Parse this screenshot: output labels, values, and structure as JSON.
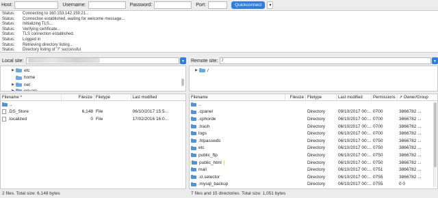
{
  "quickconnect": {
    "host_label": "Host:",
    "username_label": "Username:",
    "password_label": "Password:",
    "port_label": "Port:",
    "host_value": "",
    "username_value": "",
    "password_value": "",
    "port_value": "",
    "button_label": "Quickconnect",
    "dropdown_glyph": "▾"
  },
  "log": [
    {
      "key": "Status:",
      "text": "Connecting to 160.153.142.159:21..."
    },
    {
      "key": "Status:",
      "text": "Connection established, waiting for welcome message..."
    },
    {
      "key": "Status:",
      "text": "Initializing TLS..."
    },
    {
      "key": "Status:",
      "text": "Verifying certificate..."
    },
    {
      "key": "Status:",
      "text": "TLS connection established."
    },
    {
      "key": "Status:",
      "text": "Logged in"
    },
    {
      "key": "Status:",
      "text": "Retrieving directory listing..."
    },
    {
      "key": "Status:",
      "text": "Directory listing of \"/\" successful"
    }
  ],
  "local_site": {
    "label": "Local site:",
    "path": ""
  },
  "remote_site": {
    "label": "Remote site:",
    "path": "/"
  },
  "local_tree": [
    {
      "name": "etc",
      "arrow": "▶"
    },
    {
      "name": "home",
      "arrow": ""
    },
    {
      "name": "net",
      "arrow": "▶"
    },
    {
      "name": "private",
      "arrow": "▶"
    }
  ],
  "remote_tree": [
    {
      "name": "/",
      "arrow": "▶"
    }
  ],
  "local_list": {
    "headers": {
      "filename": "Filename",
      "sort_glyph": "^",
      "filesize": "Filesize",
      "filetype": "Filetype",
      "modified": "Last modified"
    },
    "rows": [
      {
        "name": "..",
        "size": "",
        "type": "",
        "modified": "",
        "kind": "folder"
      },
      {
        "name": ".DS_Store",
        "size": "6,148",
        "type": "File",
        "modified": "06/10/2017 15:5...",
        "kind": "file"
      },
      {
        "name": ".localized",
        "size": "0",
        "type": "File",
        "modified": "17/02/2016 16:0...",
        "kind": "file"
      }
    ],
    "status": "2 files. Total size: 6,148 bytes"
  },
  "remote_list": {
    "headers": {
      "filename": "Filename",
      "filesize": "Filesize",
      "filetype": "Filetype",
      "modified": "Last modified",
      "permissions": "Permissions",
      "owner": "Owner/Group",
      "owner_glyph": "↗"
    },
    "rows": [
      {
        "name": "..",
        "type": "",
        "modified": "",
        "perm": "",
        "owner": ""
      },
      {
        "name": ".cpanel",
        "type": "Directory",
        "modified": "09/10/2017 00:...",
        "perm": "0700",
        "owner": "3866782 ..."
      },
      {
        "name": ".cphorde",
        "type": "Directory",
        "modified": "06/10/2017 00:...",
        "perm": "0700",
        "owner": "3866782 ..."
      },
      {
        "name": ".trash",
        "type": "Directory",
        "modified": "06/10/2017 00:...",
        "perm": "0700",
        "owner": "3866782 ..."
      },
      {
        "name": "logs",
        "type": "Directory",
        "modified": "06/10/2017 00:...",
        "perm": "0700",
        "owner": "3866782 ..."
      },
      {
        "name": ".htpasswds",
        "type": "Directory",
        "modified": "06/10/2017 00:...",
        "perm": "0750",
        "owner": "3866782 ..."
      },
      {
        "name": "etc",
        "type": "Directory",
        "modified": "06/10/2017 00:...",
        "perm": "0750",
        "owner": "3866782 ..."
      },
      {
        "name": "public_ftp",
        "type": "Directory",
        "modified": "06/10/2017 00:...",
        "perm": "0750",
        "owner": "3866782 ..."
      },
      {
        "name": "public_html",
        "type": "Directory",
        "modified": "06/10/2017 00:...",
        "perm": "0750",
        "owner": "3866782 ...",
        "highlight": true
      },
      {
        "name": "mail",
        "type": "Directory",
        "modified": "06/10/2017 00:...",
        "perm": "0751",
        "owner": "3866782 ..."
      },
      {
        "name": ".cl.selector",
        "type": "Directory",
        "modified": "06/10/2017 00:...",
        "perm": "0755",
        "owner": "3866782 ..."
      },
      {
        "name": ".mysql_backup",
        "type": "Directory",
        "modified": "06/10/2017 00:...",
        "perm": "0755",
        "owner": "0 0"
      }
    ],
    "status": "7 files and 15 directories. Total size: 1,051 bytes"
  },
  "colors": {
    "accent": "#2d7de8",
    "folder": "#4a93e0",
    "highlight": "#e8e81e"
  }
}
